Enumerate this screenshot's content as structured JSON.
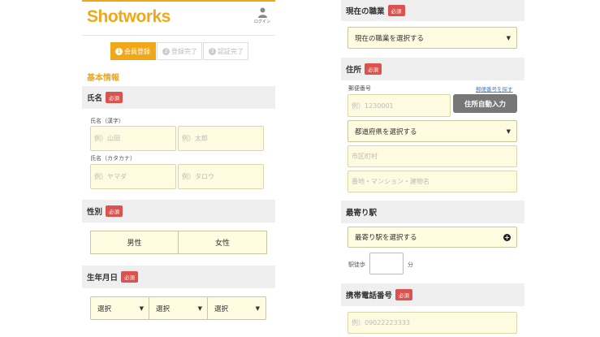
{
  "header": {
    "logo": "Shotworks",
    "login_label": "ログイン"
  },
  "steps": [
    {
      "num": "1",
      "label": "会員登録"
    },
    {
      "num": "2",
      "label": "登録完了"
    },
    {
      "num": "3",
      "label": "認証完了"
    }
  ],
  "basic_info_title": "基本情報",
  "required_badge": "必須",
  "name": {
    "label": "氏名",
    "kanji_label": "氏名（漢字）",
    "kanji_last_placeholder": "例）山田",
    "kanji_first_placeholder": "例）太郎",
    "kana_label": "氏名（カタカナ）",
    "kana_last_placeholder": "例）ヤマダ",
    "kana_first_placeholder": "例）タロウ"
  },
  "gender": {
    "label": "性別",
    "male": "男性",
    "female": "女性"
  },
  "birthdate": {
    "label": "生年月日",
    "select_text": "選択"
  },
  "occupation": {
    "label": "現在の職業",
    "select_text": "現在の職業を選択する"
  },
  "address": {
    "label": "住所",
    "postal_label": "郵便番号",
    "postal_lookup_link": "郵便番号を探す",
    "postal_placeholder": "例）1230001",
    "auto_fill_button": "住所自動入力",
    "prefecture_select": "都道府県を選択する",
    "city_placeholder": "市区町村",
    "building_placeholder": "番地・マンション・建物名"
  },
  "station": {
    "label": "最寄り駅",
    "select_text": "最寄り駅を選択する",
    "walk_label": "駅徒歩",
    "minutes_unit": "分"
  },
  "phone": {
    "label": "携帯電話番号",
    "placeholder": "例）09022223333"
  },
  "colors": {
    "brand": "#f0a818",
    "required": "#d9534f",
    "field_bg": "#fffbe0"
  }
}
